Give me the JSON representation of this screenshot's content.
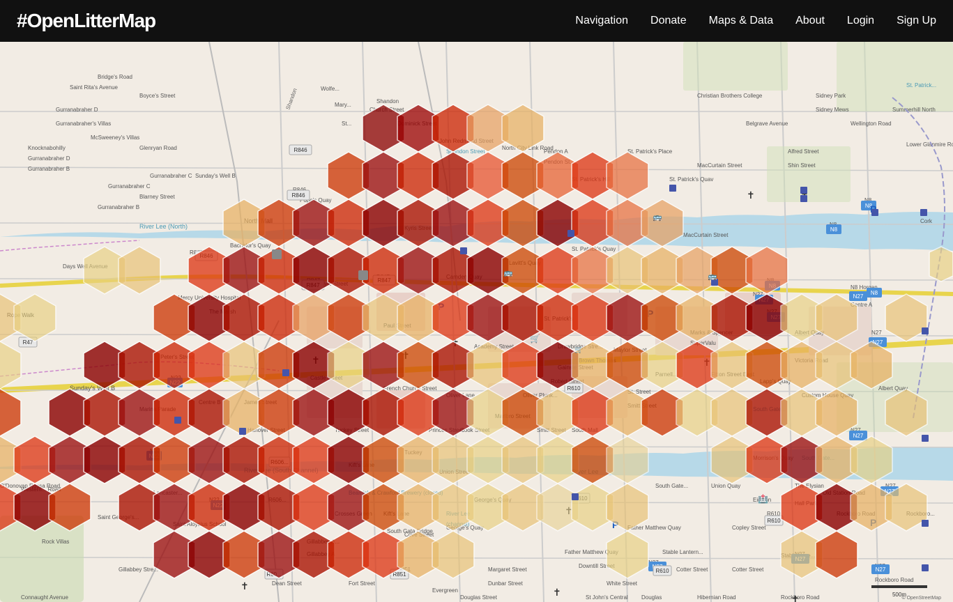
{
  "header": {
    "logo": "#OpenLitterMap",
    "nav": [
      {
        "label": "Navigation",
        "id": "nav-navigation"
      },
      {
        "label": "Donate",
        "id": "nav-donate"
      },
      {
        "label": "Maps & Data",
        "id": "nav-maps-data"
      },
      {
        "label": "About",
        "id": "nav-about"
      },
      {
        "label": "Login",
        "id": "nav-login"
      },
      {
        "label": "Sign Up",
        "id": "nav-signup"
      }
    ]
  },
  "map": {
    "center": "Cork, Ireland",
    "hexagons": []
  }
}
